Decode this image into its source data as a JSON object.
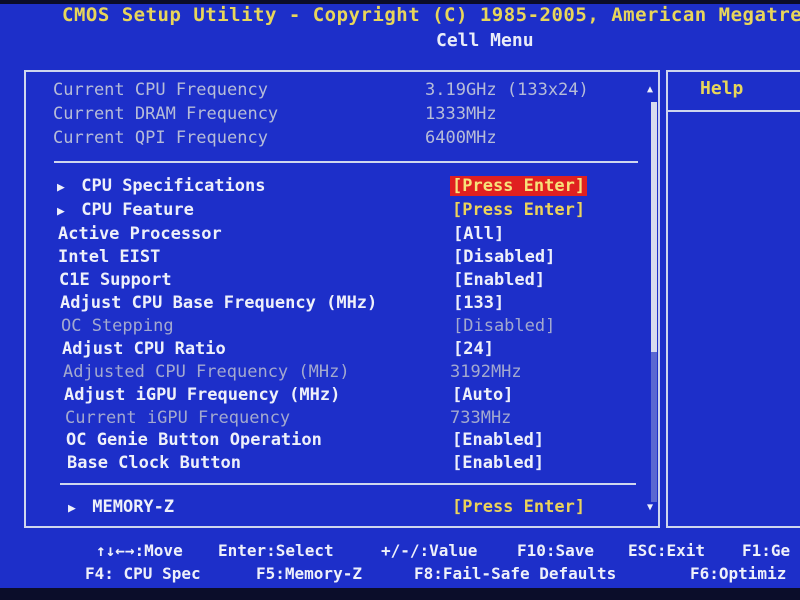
{
  "title": "CMOS Setup Utility - Copyright (C) 1985-2005, American Megatre",
  "subtitle": "Cell Menu",
  "help": {
    "header": "Help"
  },
  "info": [
    {
      "label": "Current CPU Frequency",
      "value": "3.19GHz (133x24)"
    },
    {
      "label": "Current DRAM Frequency",
      "value": "1333MHz"
    },
    {
      "label": "Current QPI Frequency",
      "value": "6400MHz"
    }
  ],
  "settings": [
    {
      "label": "CPU Specifications",
      "value": "[Press Enter]",
      "submenu": true,
      "state": "selected"
    },
    {
      "label": "CPU Feature",
      "value": "[Press Enter]",
      "submenu": true,
      "state": "normal"
    },
    {
      "label": "Active Processor",
      "value": "[All]",
      "state": "normal"
    },
    {
      "label": "Intel EIST",
      "value": "[Disabled]",
      "state": "normal"
    },
    {
      "label": "C1E Support",
      "value": "[Enabled]",
      "state": "normal"
    },
    {
      "label": "Adjust CPU Base Frequency (MHz)",
      "value": "[133]",
      "state": "normal"
    },
    {
      "label": "OC Stepping",
      "value": "[Disabled]",
      "state": "disabled"
    },
    {
      "label": "Adjust CPU Ratio",
      "value": "[24]",
      "state": "normal"
    },
    {
      "label": "Adjusted CPU Frequency (MHz)",
      "value": "3192MHz",
      "state": "disabled"
    },
    {
      "label": "Adjust iGPU Frequency (MHz)",
      "value": "[Auto]",
      "state": "normal"
    },
    {
      "label": "Current iGPU Frequency",
      "value": "733MHz",
      "state": "disabled"
    },
    {
      "label": "OC Genie Button Operation",
      "value": "[Enabled]",
      "state": "normal"
    },
    {
      "label": "Base Clock Button",
      "value": "[Enabled]",
      "state": "normal"
    }
  ],
  "memory": {
    "label": "MEMORY-Z",
    "value": "[Press Enter]"
  },
  "footer": {
    "line1": [
      "↑↓←→:Move",
      "Enter:Select",
      "+/-/:Value",
      "F10:Save",
      "ESC:Exit",
      "F1:Ge"
    ],
    "line2": [
      "F4: CPU Spec",
      "F5:Memory-Z",
      "F8:Fail-Safe Defaults",
      "F6:Optimiz"
    ]
  },
  "colors": {
    "background": "#1d2fc9",
    "title": "#e8d65a",
    "selected_bg": "#e02020",
    "highlight_value": "#ecd35a",
    "disabled_text": "#a3a9cf"
  }
}
